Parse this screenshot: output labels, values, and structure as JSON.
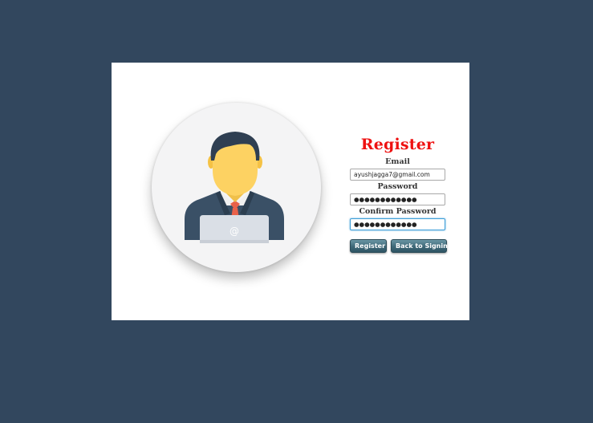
{
  "form": {
    "title": "Register",
    "email": {
      "label": "Email",
      "value": "ayushjagga7@gmail.com"
    },
    "password": {
      "label": "Password",
      "value": "●●●●●●●●●●●●"
    },
    "confirm_password": {
      "label": "Confirm Password",
      "value": "●●●●●●●●●●●●"
    }
  },
  "buttons": {
    "register_label": "Register",
    "back_label": "Back to Signin"
  },
  "avatar": {
    "icon": "user-avatar-icon",
    "laptop_symbol": "@"
  },
  "colors": {
    "background": "#32475e",
    "title": "#ee1111",
    "button": "#3e6878",
    "focus": "#3d9ed8"
  }
}
